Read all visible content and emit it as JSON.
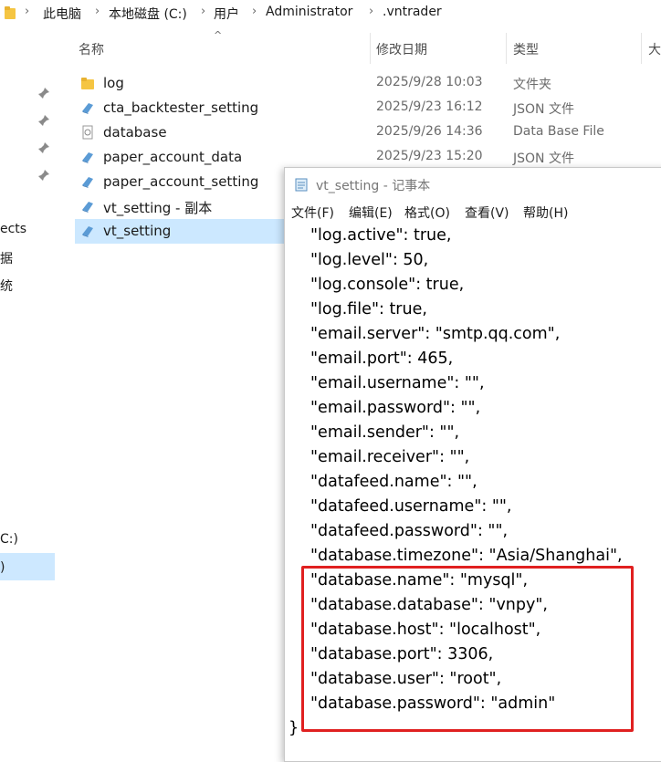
{
  "address_bar": {
    "crumbs": [
      "此电脑",
      "本地磁盘 (C:)",
      "用户",
      "Administrator",
      ".vntrader"
    ]
  },
  "left_pane": {
    "items": [
      "ects",
      "据",
      "统",
      "C:)",
      ")"
    ]
  },
  "columns": {
    "name": "名称",
    "modified": "修改日期",
    "type": "类型",
    "size": "大"
  },
  "files": [
    {
      "name": "log",
      "modified": "2025/9/28 10:03",
      "type": "文件夹",
      "icon": "folder-icon"
    },
    {
      "name": "cta_backtester_setting",
      "modified": "2025/9/23 16:12",
      "type": "JSON 文件",
      "icon": "json-file-icon"
    },
    {
      "name": "database",
      "modified": "2025/9/26 14:36",
      "type": "Data Base File",
      "icon": "db-file-icon"
    },
    {
      "name": "paper_account_data",
      "modified": "2025/9/23 15:20",
      "type": "JSON 文件",
      "icon": "json-file-icon"
    },
    {
      "name": "paper_account_setting",
      "modified": "",
      "type": "",
      "icon": "json-file-icon"
    },
    {
      "name": "vt_setting - 副本",
      "modified": "",
      "type": "",
      "icon": "json-file-icon"
    },
    {
      "name": "vt_setting",
      "modified": "",
      "type": "",
      "icon": "json-file-icon",
      "selected": true
    }
  ],
  "notepad": {
    "title": "vt_setting - 记事本",
    "menu": [
      "文件(F)",
      "编辑(E)",
      "格式(O)",
      "查看(V)",
      "帮助(H)"
    ],
    "lines": [
      "\"log.active\": true,",
      "\"log.level\": 50,",
      "\"log.console\": true,",
      "\"log.file\": true,",
      "\"email.server\": \"smtp.qq.com\",",
      "\"email.port\": 465,",
      "\"email.username\": \"\",",
      "\"email.password\": \"\",",
      "\"email.sender\": \"\",",
      "\"email.receiver\": \"\",",
      "\"datafeed.name\": \"\",",
      "\"datafeed.username\": \"\",",
      "\"datafeed.password\": \"\",",
      "\"database.timezone\": \"Asia/Shanghai\",",
      "\"database.name\": \"mysql\",",
      "\"database.database\": \"vnpy\",",
      "\"database.host\": \"localhost\",",
      "\"database.port\": 3306,",
      "\"database.user\": \"root\",",
      "\"database.password\": \"admin\""
    ],
    "closing_brace": "}",
    "highlight_color": "#e02020"
  }
}
